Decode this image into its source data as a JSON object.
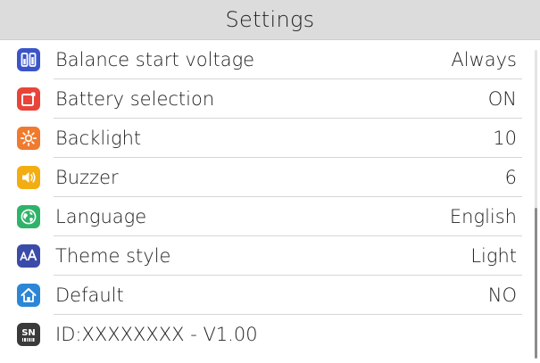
{
  "header": {
    "title": "Settings"
  },
  "items": [
    {
      "label": "Balance start voltage",
      "value": "Always",
      "icon": "battery-balance-icon",
      "color": "#3b55c9"
    },
    {
      "label": "Battery selection",
      "value": "ON",
      "icon": "battery-select-icon",
      "color": "#e8443a"
    },
    {
      "label": "Backlight",
      "value": "10",
      "icon": "sun-icon",
      "color": "#f07a2e"
    },
    {
      "label": "Buzzer",
      "value": "6",
      "icon": "speaker-icon",
      "color": "#f1ad12"
    },
    {
      "label": "Language",
      "value": "English",
      "icon": "globe-icon",
      "color": "#2fb36a"
    },
    {
      "label": "Theme style",
      "value": "Light",
      "icon": "font-size-icon",
      "color": "#3b4ba8"
    },
    {
      "label": "Default",
      "value": "NO",
      "icon": "home-icon",
      "color": "#2c86d6"
    },
    {
      "label": "ID:XXXXXXXX - V1.00",
      "value": "",
      "icon": "serial-number-icon",
      "color": "#3a3a3a",
      "icon_text": "SN"
    }
  ]
}
